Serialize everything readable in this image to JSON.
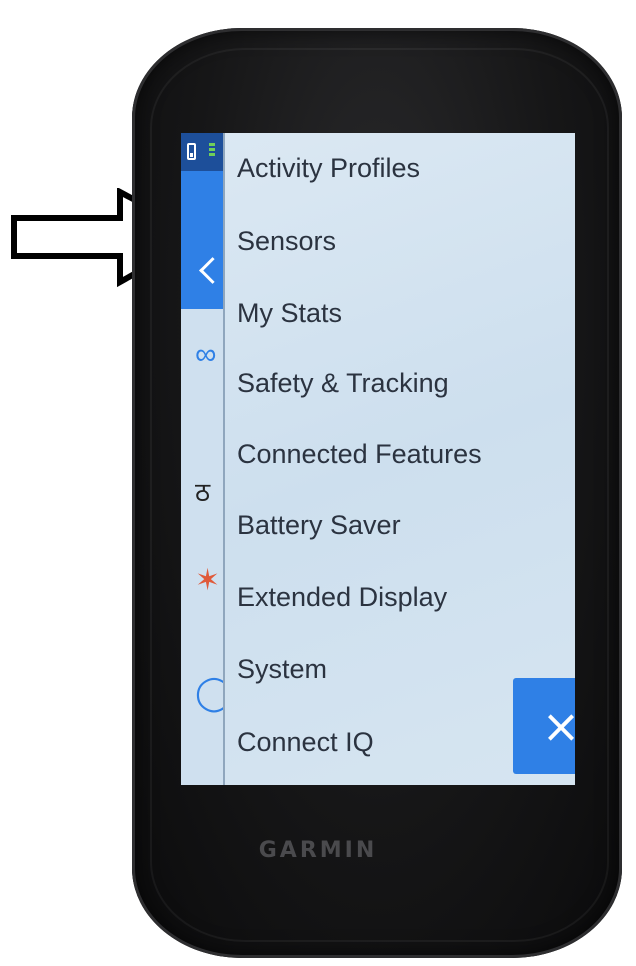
{
  "device": {
    "brand": "GARMIN"
  },
  "colors": {
    "accent": "#2f80e6",
    "screen_bg": "#cfe0ef",
    "menu_text": "#2b3340",
    "battery_signal": "#6fcf5a",
    "activity_icon": "#e05a3a"
  },
  "background_panel": {
    "icons": [
      "back-chevron-icon",
      "rings-icon",
      "cyclist-icon",
      "person-icon",
      "circle-icon"
    ]
  },
  "menu": {
    "items": [
      {
        "label": "Activity Profiles"
      },
      {
        "label": "Sensors"
      },
      {
        "label": "My Stats"
      },
      {
        "label": "Safety & Tracking"
      },
      {
        "label": "Connected Features"
      },
      {
        "label": "Battery Saver"
      },
      {
        "label": "Extended Display"
      },
      {
        "label": "System"
      },
      {
        "label": "Connect IQ"
      }
    ],
    "close_icon": "×"
  },
  "annotation": {
    "points_to": "Sensors"
  }
}
